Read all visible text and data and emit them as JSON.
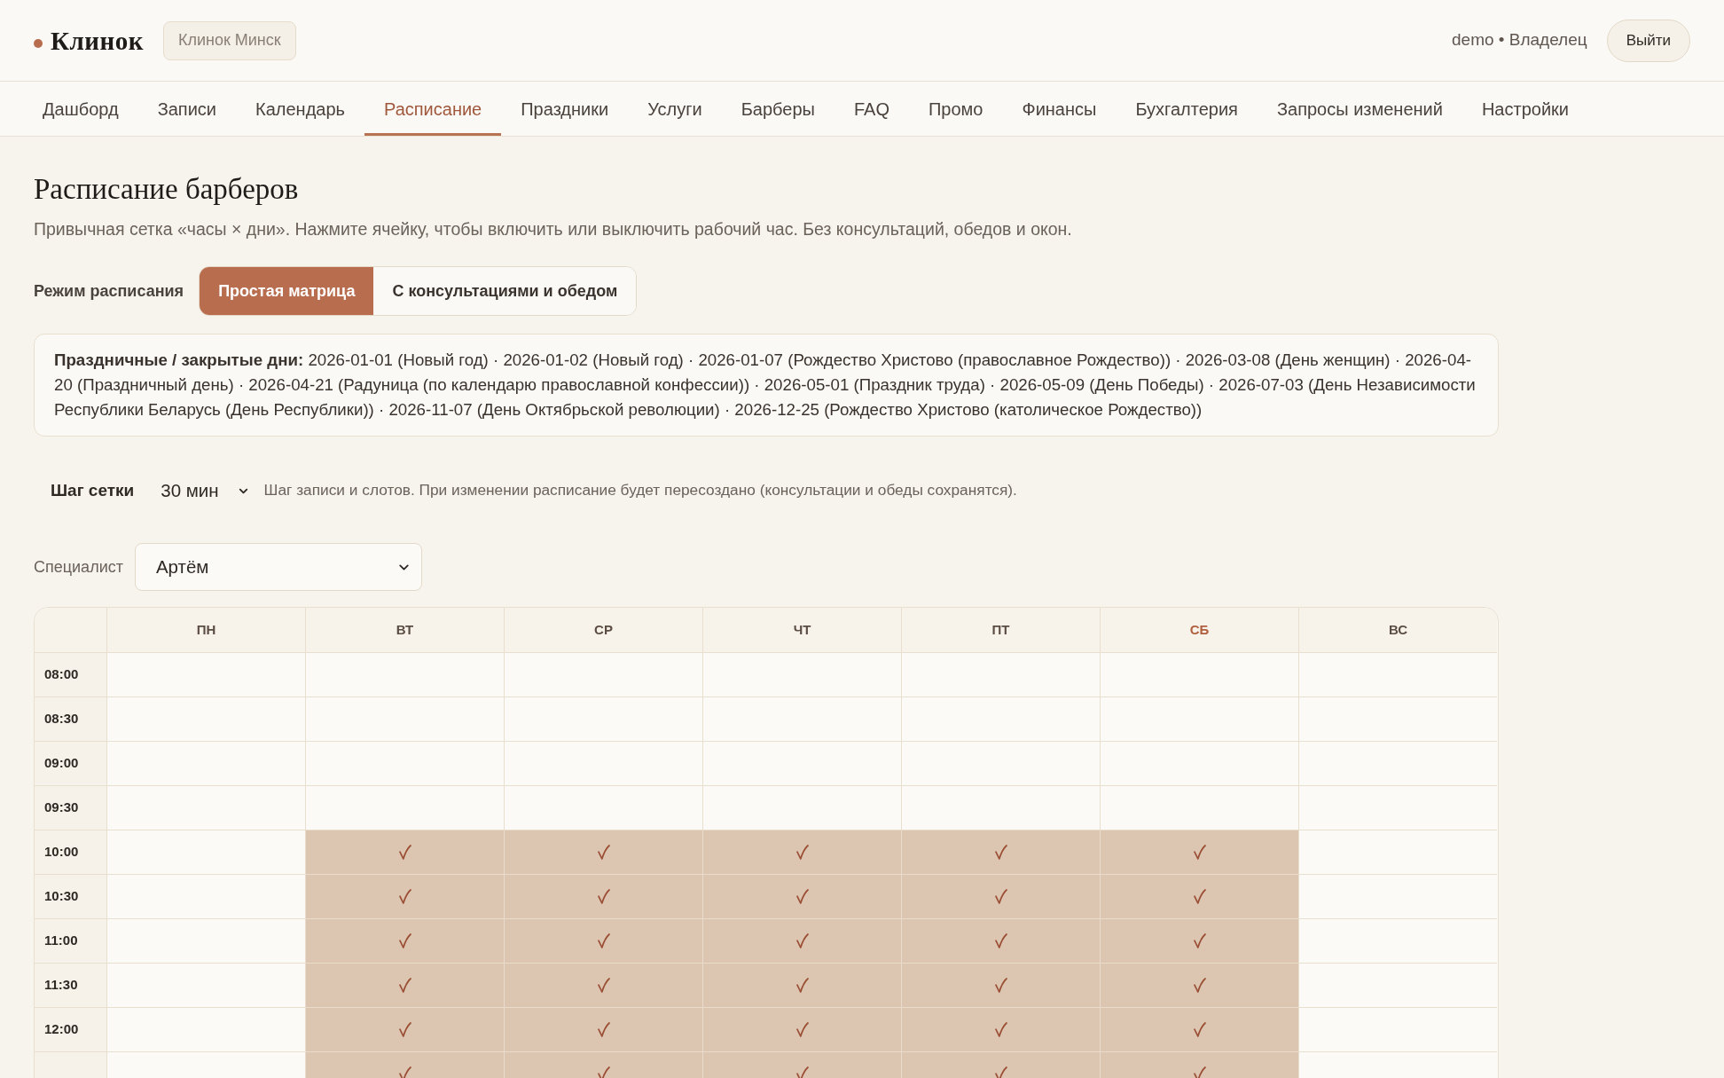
{
  "header": {
    "logo": "Клинок",
    "branch": "Клинок Минск",
    "user": "demo • Владелец",
    "logout_button": "Выйти"
  },
  "nav": [
    {
      "label": "Дашборд",
      "selected": false
    },
    {
      "label": "Записи",
      "selected": false
    },
    {
      "label": "Календарь",
      "selected": false
    },
    {
      "label": "Расписание",
      "selected": true
    },
    {
      "label": "Праздники",
      "selected": false
    },
    {
      "label": "Услуги",
      "selected": false
    },
    {
      "label": "Барберы",
      "selected": false
    },
    {
      "label": "FAQ",
      "selected": false
    },
    {
      "label": "Промо",
      "selected": false
    },
    {
      "label": "Финансы",
      "selected": false
    },
    {
      "label": "Бухгалтерия",
      "selected": false
    },
    {
      "label": "Запросы изменений",
      "selected": false
    },
    {
      "label": "Настройки",
      "selected": false
    }
  ],
  "page": {
    "title": "Расписание барберов",
    "subtitle": "Привычная сетка «часы × дни». Нажмите ячейку, чтобы включить или выключить рабочий час. Без консультаций, обедов и окон."
  },
  "mode": {
    "label": "Режим расписания",
    "options": [
      {
        "label": "Простая матрица",
        "selected": true
      },
      {
        "label": "С консультациями и обедом",
        "selected": false
      }
    ]
  },
  "holidays": {
    "text": "**Праздничные / закрытые дни:** 2026-01-01 (Новый год) · 2026-01-02 (Новый год) · 2026-01-07 (Рождество Христово (православное Рождество)) · 2026-03-08 (День женщин) · 2026-04-20 (Праздничный день) · 2026-04-21 (Радуница (по календарю православной конфессии)) · 2026-05-01 (Праздник труда) · 2026-05-09 (День Победы) · 2026-07-03 (День Независимости Республики Беларусь (День Республики)) · 2026-11-07 (День Октябрьской революции) · 2026-12-25 (Рождество Христово (католическое Рождество))"
  },
  "grid_step": {
    "label": "Шаг сетки",
    "value": "30 мин",
    "hint": "Шаг записи и слотов. При изменении расписание будет пересоздано (консультации и обеды сохранятся)."
  },
  "specialist": {
    "label": "Специалист",
    "value": "Артём"
  },
  "schedule": {
    "days": [
      {
        "label": "ПН",
        "today": false
      },
      {
        "label": "ВТ",
        "today": false
      },
      {
        "label": "СР",
        "today": false
      },
      {
        "label": "ЧТ",
        "today": false
      },
      {
        "label": "ПТ",
        "today": false
      },
      {
        "label": "СБ",
        "today": true
      },
      {
        "label": "ВС",
        "today": false
      }
    ],
    "rows": [
      {
        "time": "08:00",
        "cells": [
          {
            "on": false
          },
          {
            "on": false
          },
          {
            "on": false
          },
          {
            "on": false
          },
          {
            "on": false
          },
          {
            "on": false
          },
          {
            "on": false
          }
        ]
      },
      {
        "time": "08:30",
        "cells": [
          {
            "on": false
          },
          {
            "on": false
          },
          {
            "on": false
          },
          {
            "on": false
          },
          {
            "on": false
          },
          {
            "on": false
          },
          {
            "on": false
          }
        ]
      },
      {
        "time": "09:00",
        "cells": [
          {
            "on": false
          },
          {
            "on": false
          },
          {
            "on": false
          },
          {
            "on": false
          },
          {
            "on": false
          },
          {
            "on": false
          },
          {
            "on": false
          }
        ]
      },
      {
        "time": "09:30",
        "cells": [
          {
            "on": false
          },
          {
            "on": false
          },
          {
            "on": false
          },
          {
            "on": false
          },
          {
            "on": false
          },
          {
            "on": false
          },
          {
            "on": false
          }
        ]
      },
      {
        "time": "10:00",
        "cells": [
          {
            "on": false
          },
          {
            "on": true
          },
          {
            "on": true
          },
          {
            "on": true
          },
          {
            "on": true
          },
          {
            "on": true
          },
          {
            "on": false
          }
        ]
      },
      {
        "time": "10:30",
        "cells": [
          {
            "on": false
          },
          {
            "on": true
          },
          {
            "on": true
          },
          {
            "on": true
          },
          {
            "on": true
          },
          {
            "on": true
          },
          {
            "on": false
          }
        ]
      },
      {
        "time": "11:00",
        "cells": [
          {
            "on": false
          },
          {
            "on": true
          },
          {
            "on": true
          },
          {
            "on": true
          },
          {
            "on": true
          },
          {
            "on": true
          },
          {
            "on": false
          }
        ]
      },
      {
        "time": "11:30",
        "cells": [
          {
            "on": false
          },
          {
            "on": true
          },
          {
            "on": true
          },
          {
            "on": true
          },
          {
            "on": true
          },
          {
            "on": true
          },
          {
            "on": false
          }
        ]
      },
      {
        "time": "12:00",
        "cells": [
          {
            "on": false
          },
          {
            "on": true
          },
          {
            "on": true
          },
          {
            "on": true
          },
          {
            "on": true
          },
          {
            "on": true
          },
          {
            "on": false
          }
        ]
      },
      {
        "cells": [
          {
            "on": false
          },
          {
            "on": true
          },
          {
            "on": true
          },
          {
            "on": true
          },
          {
            "on": true
          },
          {
            "on": true
          },
          {
            "on": false
          }
        ]
      }
    ]
  }
}
